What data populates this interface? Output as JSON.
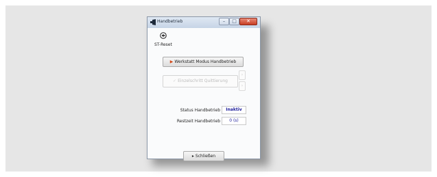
{
  "window": {
    "title": "Handbetrieb",
    "minimize_glyph": "–",
    "maximize_glyph": "□",
    "close_glyph": "✕"
  },
  "reset": {
    "icon": "reset-arrow-icon",
    "label": "ST-Reset"
  },
  "buttons": {
    "start_label": "Werkstatt Modus Handbetrieb",
    "quit_label": "Einzelschritt Quittierung",
    "close_label": "Schließen",
    "side_up": "›",
    "side_down": "›"
  },
  "status": {
    "label": "Status Handbetrieb",
    "value": "Inaktiv"
  },
  "remaining": {
    "label": "Restzeit Handbetrieb",
    "value": "0 (s)"
  },
  "colors": {
    "accent": "#d24a1a",
    "value_text": "#1a1a9a",
    "close_button": "#c73d22"
  }
}
